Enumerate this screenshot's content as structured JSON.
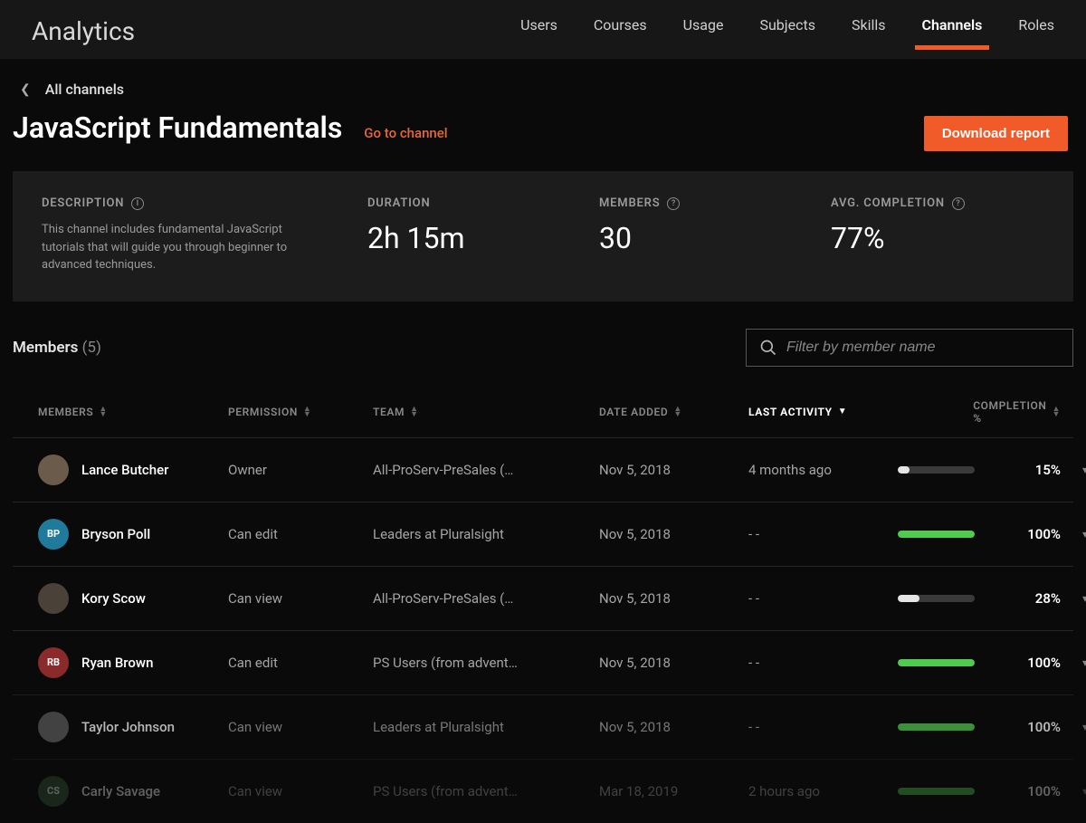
{
  "header": {
    "app_title": "Analytics",
    "tabs": [
      "Users",
      "Courses",
      "Usage",
      "Subjects",
      "Skills",
      "Channels",
      "Roles"
    ],
    "active_tab_index": 5
  },
  "breadcrumb": {
    "back_label": "All channels"
  },
  "page": {
    "title": "JavaScript Fundamentals",
    "go_to_channel": "Go to channel",
    "download_button": "Download report"
  },
  "stats": {
    "description_label": "DESCRIPTION",
    "description_text": "This channel includes fundamental JavaScript tutorials that will guide you through beginner to advanced techniques.",
    "duration_label": "DURATION",
    "duration_value": "2h 15m",
    "members_label": "MEMBERS",
    "members_value": "30",
    "avg_completion_label": "AVG. COMPLETION",
    "avg_completion_value": "77%"
  },
  "members_section": {
    "title": "Members",
    "count": "(5)",
    "filter_placeholder": "Filter by member name"
  },
  "columns": {
    "members": "MEMBERS",
    "permission": "PERMISSION",
    "team": "TEAM",
    "date_added": "DATE ADDED",
    "last_activity": "LAST ACTIVITY",
    "completion": "COMPLETION %"
  },
  "rows": [
    {
      "avatar_bg": "#6b5b4a",
      "initials": "",
      "name": "Lance Butcher",
      "permission": "Owner",
      "team": "All-ProServ-PreSales (…",
      "date_added": "Nov 5, 2018",
      "last_activity": "4 months ago",
      "completion_pct": 15,
      "completion_label": "15%",
      "bar_color": "low"
    },
    {
      "avatar_bg": "#1f7a9c",
      "initials": "BP",
      "name": "Bryson Poll",
      "permission": "Can edit",
      "team": "Leaders at Pluralsight",
      "date_added": "Nov 5, 2018",
      "last_activity": "- -",
      "completion_pct": 100,
      "completion_label": "100%",
      "bar_color": "full"
    },
    {
      "avatar_bg": "#4a4238",
      "initials": "",
      "name": "Kory Scow",
      "permission": "Can view",
      "team": "All-ProServ-PreSales (…",
      "date_added": "Nov 5, 2018",
      "last_activity": "- -",
      "completion_pct": 28,
      "completion_label": "28%",
      "bar_color": "low"
    },
    {
      "avatar_bg": "#8a2a2a",
      "initials": "RB",
      "name": "Ryan Brown",
      "permission": "Can edit",
      "team": "PS Users (from advent…",
      "date_added": "Nov 5, 2018",
      "last_activity": "- -",
      "completion_pct": 100,
      "completion_label": "100%",
      "bar_color": "full"
    },
    {
      "avatar_bg": "#5a5a5a",
      "initials": "",
      "name": "Taylor Johnson",
      "permission": "Can view",
      "team": "Leaders at Pluralsight",
      "date_added": "Nov 5, 2018",
      "last_activity": "- -",
      "completion_pct": 100,
      "completion_label": "100%",
      "bar_color": "full"
    },
    {
      "avatar_bg": "#3a5a3a",
      "initials": "CS",
      "name": "Carly Savage",
      "permission": "Can view",
      "team": "PS Users (from advent…",
      "date_added": "Mar 18, 2019",
      "last_activity": "2 hours ago",
      "completion_pct": 100,
      "completion_label": "100%",
      "bar_color": "full"
    }
  ]
}
